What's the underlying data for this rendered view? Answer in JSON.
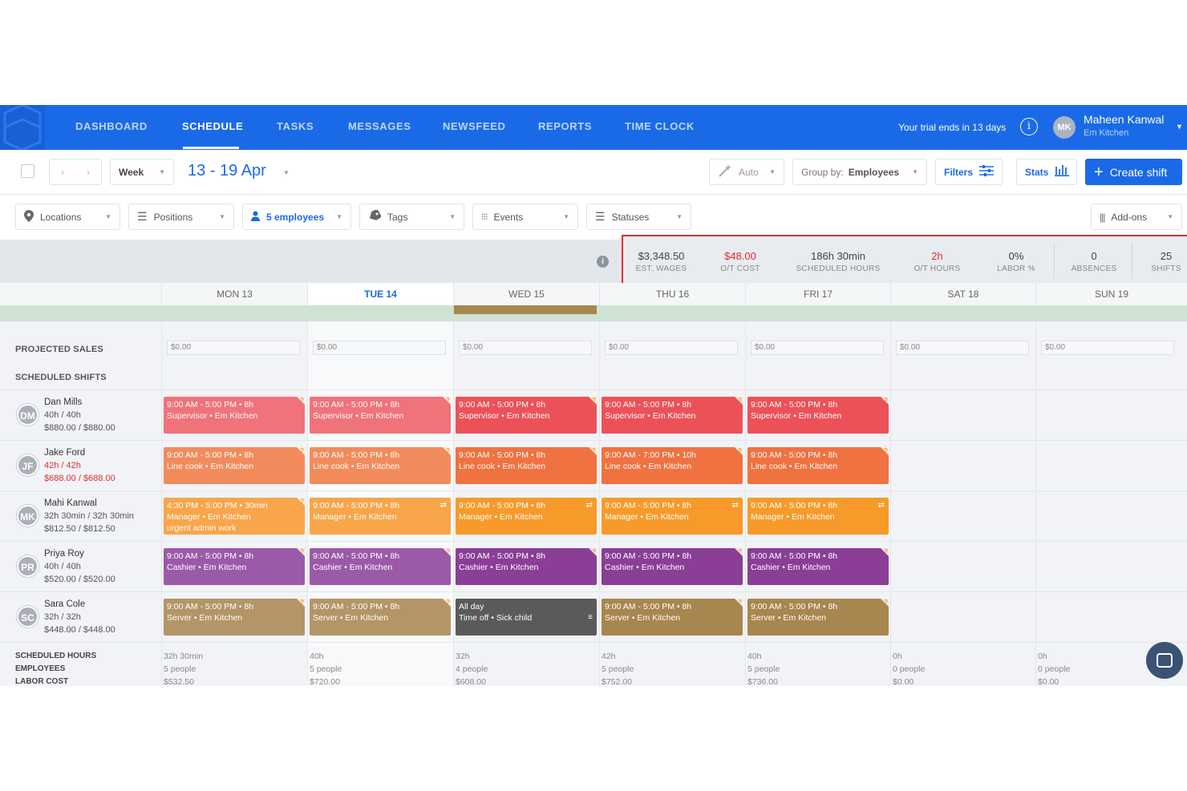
{
  "nav": {
    "items": [
      "DASHBOARD",
      "SCHEDULE",
      "TASKS",
      "MESSAGES",
      "NEWSFEED",
      "REPORTS",
      "TIME CLOCK"
    ],
    "trial": "Your trial ends in 13 days",
    "info_icon": "i",
    "avatar": "MK",
    "user_name": "Maheen Kanwal",
    "user_sub": "Em Kitchen"
  },
  "toolbar": {
    "view": "Week",
    "date_range": "13 - 19 Apr",
    "auto": "Auto",
    "group_by_label": "Group by:",
    "group_by_value": "Employees",
    "filters": "Filters",
    "stats": "Stats",
    "create_shift": "Create shift"
  },
  "filters": {
    "locations": "Locations",
    "positions": "Positions",
    "employees": "5 employees",
    "tags": "Tags",
    "events": "Events",
    "statuses": "Statuses",
    "addons": "Add-ons"
  },
  "stats": [
    {
      "value": "$3,348.50",
      "label": "EST. WAGES"
    },
    {
      "value": "$48.00",
      "label": "O/T COST",
      "red": true
    },
    {
      "value": "186h 30min",
      "label": "SCHEDULED HOURS"
    },
    {
      "value": "2h",
      "label": "O/T HOURS",
      "red": true
    },
    {
      "value": "0%",
      "label": "LABOR %"
    },
    {
      "value": "0",
      "label": "ABSENCES"
    },
    {
      "value": "25",
      "label": "SHIFTS"
    }
  ],
  "days": [
    "MON 13",
    "TUE 14",
    "WED 15",
    "THU 16",
    "FRI 17",
    "SAT 18",
    "SUN 19"
  ],
  "sections": {
    "projected_sales": "PROJECTED SALES",
    "scheduled_shifts": "SCHEDULED SHIFTS"
  },
  "sales": [
    "$0.00",
    "$0.00",
    "$0.00",
    "$0.00",
    "$0.00",
    "$0.00",
    "$0.00"
  ],
  "employees": [
    {
      "initials": "DM",
      "name": "Dan Mills",
      "hours": "40h / 40h",
      "cost": "$880.00 / $880.00"
    },
    {
      "initials": "JF",
      "name": "Jake Ford",
      "hours": "42h / 42h",
      "cost": "$688.00 / $688.00"
    },
    {
      "initials": "MK",
      "name": "Mahi Kanwal",
      "hours": "32h 30min / 32h 30min",
      "cost": "$812.50 / $812.50"
    },
    {
      "initials": "PR",
      "name": "Priya Roy",
      "hours": "40h / 40h",
      "cost": "$520.00 / $520.00"
    },
    {
      "initials": "SC",
      "name": "Sara Cole",
      "hours": "32h / 32h",
      "cost": "$448.00 / $448.00"
    }
  ],
  "shifts": [
    [
      {
        "time": "9:00 AM - 5:00 PM • 8h",
        "role": "Supervisor • Em Kitchen",
        "color": "#f0737a"
      },
      {
        "time": "9:00 AM - 5:00 PM • 8h",
        "role": "Supervisor • Em Kitchen",
        "color": "#f0737a"
      },
      {
        "time": "9:00 AM - 5:00 PM • 8h",
        "role": "Supervisor • Em Kitchen",
        "color": "#ec5158"
      },
      {
        "time": "9:00 AM - 5:00 PM • 8h",
        "role": "Supervisor • Em Kitchen",
        "color": "#ec5158"
      },
      {
        "time": "9:00 AM - 5:00 PM • 8h",
        "role": "Supervisor • Em Kitchen",
        "color": "#ec5158"
      }
    ],
    [
      {
        "time": "9:00 AM - 5:00 PM • 8h",
        "role": "Line cook • Em Kitchen",
        "color": "#f28b5c"
      },
      {
        "time": "9:00 AM - 5:00 PM • 8h",
        "role": "Line cook • Em Kitchen",
        "color": "#f28b5c"
      },
      {
        "time": "9:00 AM - 5:00 PM • 8h",
        "role": "Line cook • Em Kitchen",
        "color": "#f07240"
      },
      {
        "time": "9:00 AM - 7:00 PM • 10h",
        "role": "Line cook • Em Kitchen",
        "color": "#f07240"
      },
      {
        "time": "9:00 AM - 5:00 PM • 8h",
        "role": "Line cook • Em Kitchen",
        "color": "#f07240"
      }
    ],
    [
      {
        "time": "4:30 PM - 5:00 PM • 30min",
        "role": "Manager • Em Kitchen",
        "extra": "urgent admin work",
        "color": "#f9a54a"
      },
      {
        "time": "9:00 AM - 5:00 PM • 8h",
        "role": "Manager • Em Kitchen",
        "color": "#f9a54a",
        "swap": true
      },
      {
        "time": "9:00 AM - 5:00 PM • 8h",
        "role": "Manager • Em Kitchen",
        "color": "#f79a2a",
        "swap": true
      },
      {
        "time": "9:00 AM - 5:00 PM • 8h",
        "role": "Manager • Em Kitchen",
        "color": "#f79a2a",
        "swap": true
      },
      {
        "time": "9:00 AM - 5:00 PM • 8h",
        "role": "Manager • Em Kitchen",
        "color": "#f79a2a",
        "swap": true
      }
    ],
    [
      {
        "time": "9:00 AM - 5:00 PM • 8h",
        "role": "Cashier • Em Kitchen",
        "color": "#9b5aa8"
      },
      {
        "time": "9:00 AM - 5:00 PM • 8h",
        "role": "Cashier • Em Kitchen",
        "color": "#9b5aa8"
      },
      {
        "time": "9:00 AM - 5:00 PM • 8h",
        "role": "Cashier • Em Kitchen",
        "color": "#8a3e96"
      },
      {
        "time": "9:00 AM - 5:00 PM • 8h",
        "role": "Cashier • Em Kitchen",
        "color": "#8a3e96"
      },
      {
        "time": "9:00 AM - 5:00 PM • 8h",
        "role": "Cashier • Em Kitchen",
        "color": "#8a3e96"
      }
    ],
    [
      {
        "time": "9:00 AM - 5:00 PM • 8h",
        "role": "Server • Em Kitchen",
        "color": "#b49567"
      },
      {
        "time": "9:00 AM - 5:00 PM • 8h",
        "role": "Server • Em Kitchen",
        "color": "#b49567"
      },
      {
        "time": "All day",
        "role": "Time off • Sick child",
        "color": "#5a5a5a",
        "timeoff": true
      },
      {
        "time": "9:00 AM - 5:00 PM • 8h",
        "role": "Server • Em Kitchen",
        "color": "#a8864f"
      },
      {
        "time": "9:00 AM - 5:00 PM • 8h",
        "role": "Server • Em Kitchen",
        "color": "#a8864f"
      }
    ]
  ],
  "footer": {
    "labels": [
      "SCHEDULED HOURS",
      "EMPLOYEES",
      "LABOR COST"
    ],
    "hours": [
      "32h 30min",
      "40h",
      "32h",
      "42h",
      "40h",
      "0h",
      "0h"
    ],
    "employees": [
      "5 people",
      "5 people",
      "4 people",
      "5 people",
      "5 people",
      "0 people",
      "0 people"
    ],
    "cost": [
      "$532.50",
      "$720.00",
      "$608.00",
      "$752.00",
      "$736.00",
      "$0.00",
      "$0.00"
    ]
  },
  "colors": {
    "brand": "#1a6ae8",
    "alert": "#e32d2d"
  }
}
